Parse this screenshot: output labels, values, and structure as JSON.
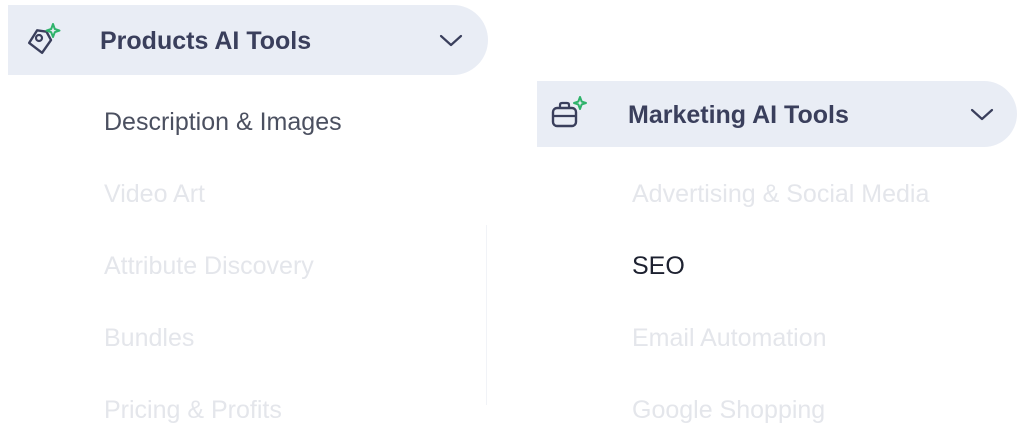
{
  "products_menu": {
    "title": "Products AI Tools",
    "icon": "tag-sparkle-icon",
    "chevron": "chevron-down-icon",
    "items": [
      {
        "label": "Description & Images",
        "state": "hover"
      },
      {
        "label": "Video Art",
        "state": "default"
      },
      {
        "label": "Attribute Discovery",
        "state": "default"
      },
      {
        "label": "Bundles",
        "state": "default"
      },
      {
        "label": "Pricing & Profits",
        "state": "default"
      }
    ]
  },
  "marketing_menu": {
    "title": "Marketing AI Tools",
    "icon": "briefcase-sparkle-icon",
    "chevron": "chevron-down-icon",
    "items": [
      {
        "label": "Advertising & Social Media",
        "state": "default"
      },
      {
        "label": "SEO",
        "state": "active"
      },
      {
        "label": "Email Automation",
        "state": "default"
      },
      {
        "label": "Google Shopping",
        "state": "default"
      }
    ]
  },
  "colors": {
    "header_bg": "#e9edf5",
    "header_text": "#3a3f5c",
    "item_default": "#e4e6eb",
    "item_hover": "#4b5060",
    "item_active": "#1d2130",
    "sparkle": "#2fb36b"
  }
}
